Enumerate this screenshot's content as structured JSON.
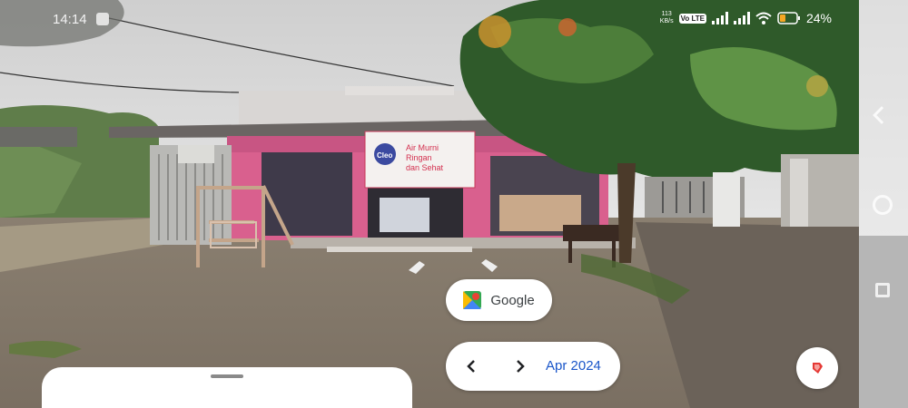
{
  "status_bar": {
    "time": "14:14",
    "net_speed_value": "113",
    "net_speed_unit": "KB/s",
    "volte": "Vo LTE",
    "battery_percent": "24%",
    "icons": [
      "signal-icon",
      "signal-icon",
      "wifi-icon",
      "battery-icon"
    ]
  },
  "street_view": {
    "banner": {
      "logo_text": "Cleo",
      "line1": "Air Murni",
      "line2": "Ringan",
      "line3": "dan Sehat"
    }
  },
  "google_chip": {
    "label": "Google",
    "icon": "google-maps-icon"
  },
  "date_nav": {
    "date": "Apr 2024",
    "prev_icon": "chevron-left-icon",
    "next_icon": "chevron-right-icon"
  },
  "bookmark_button": {
    "icon": "bookmark-icon",
    "color": "#e53935"
  },
  "side_nav": {
    "icons": [
      "back-icon",
      "home-icon",
      "recents-icon"
    ]
  }
}
